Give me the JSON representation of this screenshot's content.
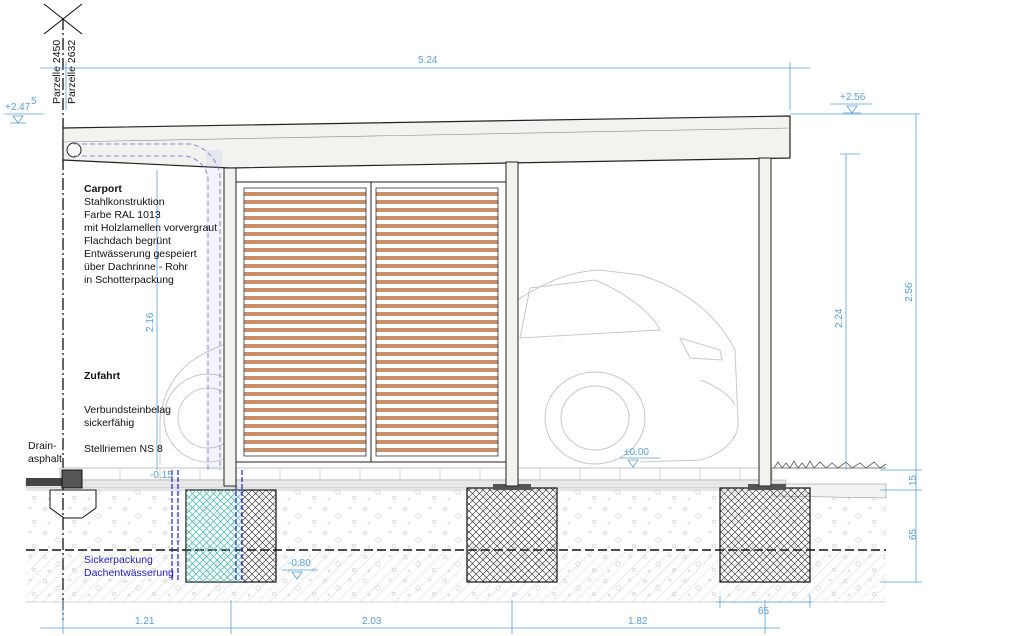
{
  "parcels": {
    "left": "Parzelle 2450",
    "right": "Parzelle 2632"
  },
  "levels": {
    "left_top": "+2.47",
    "left_top_sup": "5",
    "right_top": "+2.56",
    "zero": "±0.00",
    "minus_small": "-0.15",
    "minus_deep": "-0.80"
  },
  "dimensions": {
    "total_width": "5.24",
    "post_height_left": "2.16",
    "post_height_right": "2.24",
    "total_height": "2.56",
    "layer_top": "15",
    "layer_bottom": "65",
    "foundation_width": "65",
    "seg1": "1.21",
    "seg2": "2.03",
    "seg3": "1.82"
  },
  "carport": {
    "title": "Carport",
    "lines": [
      "Stahlkonstruktion",
      "Farbe RAL 1013",
      "mit Holzlamellen vorvergraut",
      "Flachdach begrünt",
      "Entwässerung gespeiert",
      "über Dachrinne - Rohr",
      "in Schotterpackung"
    ]
  },
  "zufahrt": {
    "title": "Zufahrt",
    "lines": [
      "Verbundsteinbelag",
      "sickerfähig"
    ],
    "stellriemen": "Stellriemen NS 8"
  },
  "drain": {
    "line1": "Drain-",
    "line2": "asphalt"
  },
  "sickerpackung": {
    "line1": "Sickerpackung",
    "line2": "Dachentwässerung"
  },
  "colors": {
    "dimension": "#5aa0d8",
    "wood": "#c8906a",
    "steel": "#f2f2ee",
    "drainage": "#2222cc",
    "gravel": "#55ddcc"
  }
}
